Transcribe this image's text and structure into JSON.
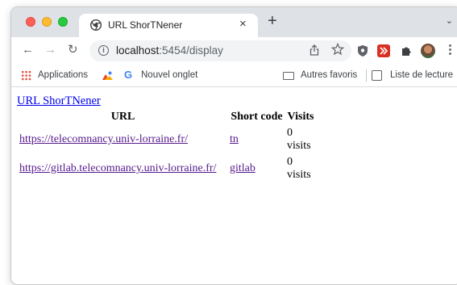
{
  "browser": {
    "tab": {
      "title": "URL ShorTNener",
      "close_glyph": "×"
    },
    "new_tab_glyph": "+",
    "tab_list_glyph": "⌄",
    "nav": {
      "back": "←",
      "forward": "→",
      "reload": "↻"
    },
    "address": {
      "host": "localhost",
      "rest": ":5454/display"
    },
    "bookmarks": {
      "apps_label": "Applications",
      "new_tab_label": "Nouvel onglet",
      "other_label": "Autres favoris",
      "reading_list_label": "Liste de lecture"
    },
    "colors": {
      "tabstrip": "#dee1e6",
      "omnibox": "#f1f3f4"
    }
  },
  "page": {
    "link_label": "URL ShorTNener",
    "table": {
      "headers": {
        "url": "URL",
        "code": "Short code",
        "visits": "Visits"
      },
      "rows": [
        {
          "url": "https://telecomnancy.univ-lorraine.fr/",
          "code": "tn",
          "visits": "0 visits"
        },
        {
          "url": "https://gitlab.telecomnancy.univ-lorraine.fr/",
          "code": "gitlab",
          "visits": "0 visits"
        }
      ]
    }
  },
  "icons": [
    "chrome-favicon-icon",
    "info-icon",
    "share-icon",
    "star-icon",
    "shield-extension-icon",
    "red-extension-icon",
    "puzzle-icon",
    "avatar",
    "menu-icon",
    "apps-icon",
    "photos-icon",
    "google-icon",
    "folder-icon",
    "reading-list-icon"
  ]
}
